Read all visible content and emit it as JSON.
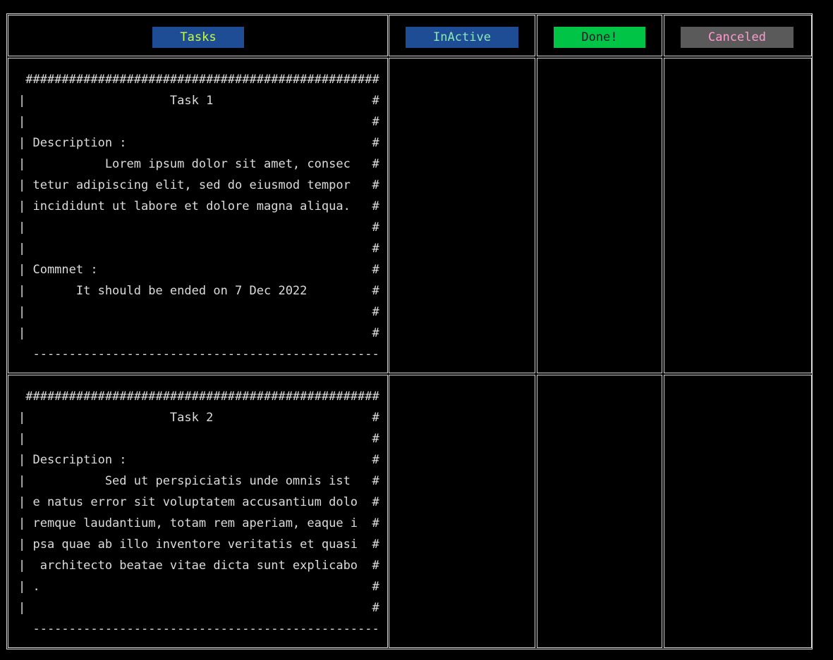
{
  "columns": [
    {
      "label": "Tasks",
      "bg": "#1e4d96",
      "fg": "#c6ff3a"
    },
    {
      "label": "InActive",
      "bg": "#1e4d96",
      "fg": "#8be8b4"
    },
    {
      "label": "Done!",
      "bg": "#00c445",
      "fg": "#2a1a2a"
    },
    {
      "label": "Canceled",
      "bg": "#5a5a5a",
      "fg": "#ff9ad0"
    }
  ],
  "cards": [
    {
      "lines": [
        " #################################################",
        "|                    Task 1                      #",
        "|                                                #",
        "| Description :                                  #",
        "|           Lorem ipsum dolor sit amet, consec   #",
        "| tetur adipiscing elit, sed do eiusmod tempor   #",
        "| incididunt ut labore et dolore magna aliqua.   #",
        "|                                                #",
        "|                                                #",
        "| Commnet :                                      #",
        "|       It should be ended on 7 Dec 2022         #",
        "|                                                #",
        "|                                                #",
        "  ------------------------------------------------"
      ]
    },
    {
      "lines": [
        " #################################################",
        "|                    Task 2                      #",
        "|                                                #",
        "| Description :                                  #",
        "|           Sed ut perspiciatis unde omnis ist   #",
        "| e natus error sit voluptatem accusantium dolo  #",
        "| remque laudantium, totam rem aperiam, eaque i  #",
        "| psa quae ab illo inventore veritatis et quasi  #",
        "|  architecto beatae vitae dicta sunt explicabo  #",
        "| .                                              #",
        "|                                                #",
        "  ------------------------------------------------"
      ]
    }
  ]
}
